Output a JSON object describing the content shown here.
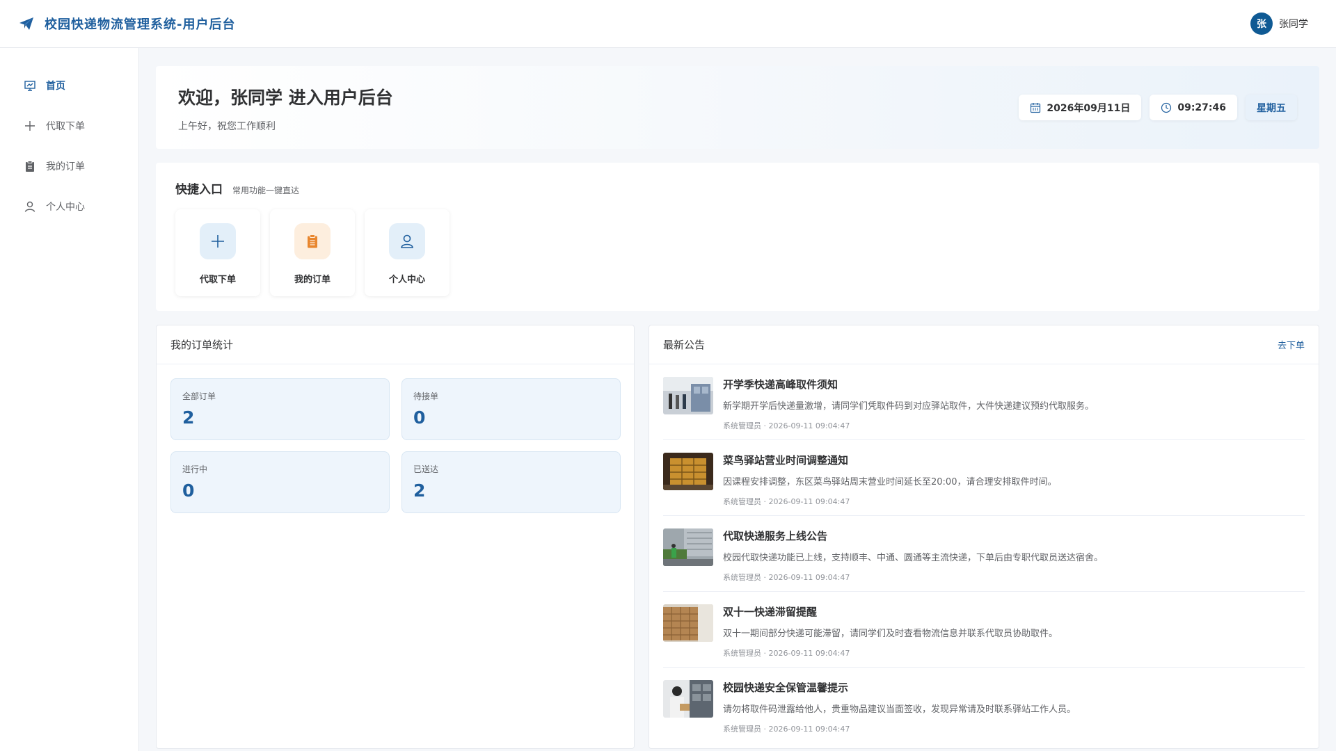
{
  "header": {
    "title": "校园快递物流管理系统-用户后台",
    "avatar_text": "张",
    "user_name": "张同学"
  },
  "sidebar": {
    "items": [
      {
        "label": "首页",
        "icon": "home-board-icon",
        "active": true
      },
      {
        "label": "代取下单",
        "icon": "plus-icon",
        "active": false
      },
      {
        "label": "我的订单",
        "icon": "clipboard-icon",
        "active": false
      },
      {
        "label": "个人中心",
        "icon": "user-icon",
        "active": false
      }
    ]
  },
  "welcome": {
    "title": "欢迎，张同学 进入用户后台",
    "subtitle": "上午好，祝您工作顺利",
    "date": "2026年09月11日",
    "time": "09:27:46",
    "weekday": "星期五"
  },
  "quick": {
    "title": "快捷入口",
    "subtitle": "常用功能一键直达",
    "items": [
      {
        "label": "代取下单",
        "icon": "plus-icon"
      },
      {
        "label": "我的订单",
        "icon": "clipboard-icon"
      },
      {
        "label": "个人中心",
        "icon": "user-icon"
      }
    ]
  },
  "stats": {
    "title": "我的订单统计",
    "items": [
      {
        "label": "全部订单",
        "value": "2"
      },
      {
        "label": "待接单",
        "value": "0"
      },
      {
        "label": "进行中",
        "value": "0"
      },
      {
        "label": "已送达",
        "value": "2"
      }
    ]
  },
  "notices": {
    "title": "最新公告",
    "link": "去下单",
    "items": [
      {
        "title": "开学季快递高峰取件须知",
        "text": "新学期开学后快递量激增，请同学们凭取件码到对应驿站取件，大件快递建议预约代取服务。",
        "meta": "系统管理员 · 2026-09-11 09:04:47"
      },
      {
        "title": "菜鸟驿站营业时间调整通知",
        "text": "因课程安排调整，东区菜鸟驿站周末营业时间延长至20:00，请合理安排取件时间。",
        "meta": "系统管理员 · 2026-09-11 09:04:47"
      },
      {
        "title": "代取快递服务上线公告",
        "text": "校园代取快递功能已上线，支持顺丰、中通、圆通等主流快递，下单后由专职代取员送达宿舍。",
        "meta": "系统管理员 · 2026-09-11 09:04:47"
      },
      {
        "title": "双十一快递滞留提醒",
        "text": "双十一期间部分快递可能滞留，请同学们及时查看物流信息并联系代取员协助取件。",
        "meta": "系统管理员 · 2026-09-11 09:04:47"
      },
      {
        "title": "校园快递安全保管温馨提示",
        "text": "请勿将取件码泄露给他人，贵重物品建议当面签收，发现异常请及时联系驿站工作人员。",
        "meta": "系统管理员 · 2026-09-11 09:04:47"
      }
    ]
  },
  "colors": {
    "accent": "#1f5f9e",
    "avatar_bg": "#0f5a94",
    "orange": "#e8862e"
  }
}
